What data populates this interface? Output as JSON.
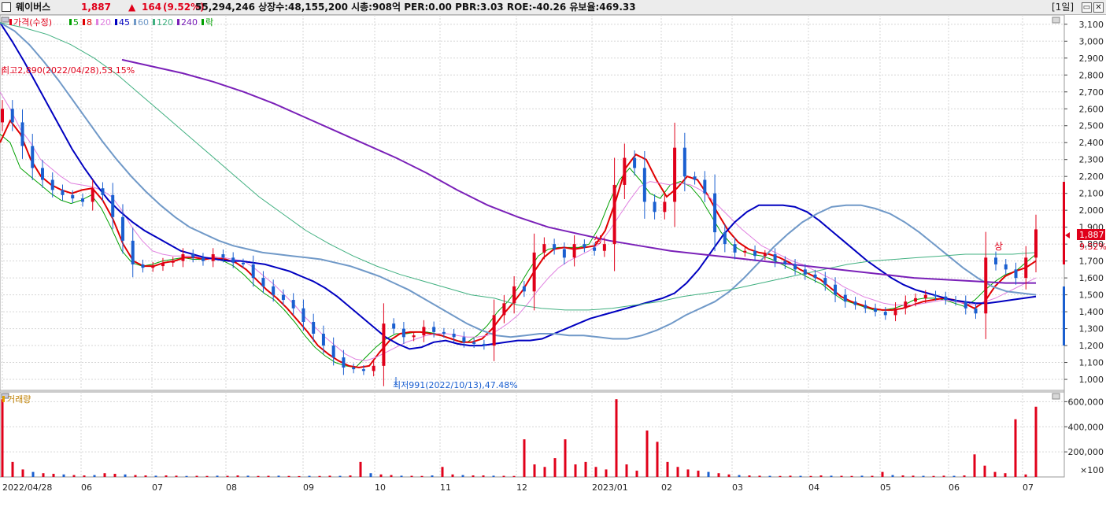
{
  "header": {
    "stock_name": "웨이버스",
    "price": "1,887",
    "change_arrow": "▲",
    "change": "164",
    "change_pct": "(9.52%)",
    "stats": "55,294,246  상장수:48,155,200  시총:908억  PER:0.00  PBR:3.03  ROE:-40.26  유보율:469.33",
    "period": "[1일]",
    "btn_restore": "▭",
    "btn_close": "✕"
  },
  "legend": {
    "items": [
      {
        "label": "가격(수정)",
        "color": "#e0001a"
      },
      {
        "label": "5",
        "color": "#00a000"
      },
      {
        "label": "8",
        "color": "#e00000"
      },
      {
        "label": "20",
        "color": "#e080e0"
      },
      {
        "label": "45",
        "color": "#0000c0"
      },
      {
        "label": "60",
        "color": "#7099c8"
      },
      {
        "label": "120",
        "color": "#40b080"
      },
      {
        "label": "240",
        "color": "#7a20b8"
      },
      {
        "label": "락",
        "color": "#00a000"
      }
    ],
    "volume_label": "거래량"
  },
  "annotations": {
    "high": "최고2,890(2022/04/28),53.15%",
    "low": "최저991(2022/10/13),47.48%",
    "limit_up_1": "상",
    "limit_up_2": "상",
    "current_price_tag": "1,887",
    "current_pct_tag": "9.52%",
    "volume_unit": "×100"
  },
  "chart_data": [
    {
      "type": "candlestick",
      "title": "",
      "y_ticks": [
        "3,100",
        "3,000",
        "2,900",
        "2,800",
        "2,700",
        "2,600",
        "2,500",
        "2,400",
        "2,300",
        "2,200",
        "2,100",
        "2,000",
        "1,900",
        "1,800",
        "1,700",
        "1,600",
        "1,500",
        "1,400",
        "1,300",
        "1,200",
        "1,100",
        "1,000"
      ],
      "ylim": [
        935,
        3155
      ],
      "x_ticks": [
        "2022/04/28",
        "06",
        "07",
        "08",
        "09",
        "10",
        "11",
        "12",
        "2023/01",
        "02",
        "03",
        "04",
        "05",
        "06",
        "07"
      ],
      "close_path": [
        2600,
        2520,
        2380,
        2250,
        2180,
        2120,
        2090,
        2070,
        2050,
        2130,
        2090,
        1960,
        1820,
        1680,
        1660,
        1670,
        1690,
        1700,
        1740,
        1720,
        1700,
        1740,
        1720,
        1690,
        1680,
        1600,
        1550,
        1500,
        1470,
        1420,
        1340,
        1270,
        1200,
        1130,
        1070,
        1060,
        1050,
        1080,
        1330,
        1300,
        1250,
        1260,
        1310,
        1280,
        1270,
        1250,
        1220,
        1210,
        1200,
        1380,
        1450,
        1550,
        1520,
        1750,
        1800,
        1770,
        1720,
        1800,
        1780,
        1760,
        1800,
        2150,
        2310,
        2250,
        2050,
        1990,
        2050,
        2370,
        2200,
        2180,
        2100,
        1870,
        1800,
        1750,
        1760,
        1730,
        1740,
        1700,
        1680,
        1650,
        1620,
        1600,
        1560,
        1500,
        1460,
        1440,
        1420,
        1400,
        1380,
        1420,
        1460,
        1480,
        1500,
        1490,
        1470,
        1460,
        1420,
        1390,
        1720,
        1680,
        1650,
        1600,
        1720,
        1887
      ],
      "series": [
        {
          "name": "5",
          "color": "#00a000",
          "values": [
            2450,
            2400,
            2250,
            2200,
            2150,
            2100,
            2060,
            2040,
            2060,
            2090,
            2010,
            1890,
            1760,
            1690,
            1670,
            1680,
            1700,
            1710,
            1720,
            1710,
            1710,
            1720,
            1700,
            1670,
            1620,
            1560,
            1510,
            1470,
            1410,
            1340,
            1260,
            1190,
            1140,
            1100,
            1080,
            1070,
            1130,
            1190,
            1240,
            1270,
            1270,
            1280,
            1280,
            1270,
            1250,
            1230,
            1220,
            1260,
            1320,
            1400,
            1460,
            1540,
            1640,
            1730,
            1770,
            1780,
            1780,
            1780,
            1800,
            1900,
            2050,
            2180,
            2250,
            2180,
            2100,
            2070,
            2150,
            2170,
            2140,
            2070,
            1970,
            1870,
            1800,
            1760,
            1740,
            1730,
            1710,
            1680,
            1650,
            1620,
            1590,
            1560,
            1510,
            1470,
            1450,
            1430,
            1410,
            1410,
            1420,
            1440,
            1470,
            1480,
            1480,
            1470,
            1450,
            1430,
            1470,
            1530,
            1580,
            1620,
            1640,
            1690,
            1740
          ]
        },
        {
          "name": "8",
          "color": "#e00000",
          "values": [
            2400,
            2530,
            2450,
            2300,
            2200,
            2150,
            2120,
            2100,
            2120,
            2130,
            2060,
            1950,
            1800,
            1700,
            1670,
            1670,
            1690,
            1700,
            1720,
            1720,
            1710,
            1720,
            1710,
            1690,
            1650,
            1590,
            1530,
            1480,
            1420,
            1350,
            1280,
            1200,
            1150,
            1110,
            1080,
            1070,
            1080,
            1160,
            1230,
            1270,
            1280,
            1280,
            1270,
            1260,
            1240,
            1220,
            1220,
            1240,
            1300,
            1380,
            1450,
            1530,
            1630,
            1720,
            1770,
            1780,
            1770,
            1780,
            1790,
            1880,
            2050,
            2250,
            2330,
            2300,
            2180,
            2080,
            2130,
            2200,
            2180,
            2090,
            1980,
            1880,
            1810,
            1770,
            1750,
            1740,
            1720,
            1690,
            1650,
            1620,
            1590,
            1540,
            1490,
            1460,
            1440,
            1420,
            1410,
            1410,
            1420,
            1440,
            1460,
            1470,
            1480,
            1470,
            1450,
            1420,
            1460,
            1550,
            1610,
            1640,
            1660,
            1700
          ]
        },
        {
          "name": "20",
          "color": "#e080e0",
          "values": [
            2700,
            2600,
            2480,
            2400,
            2300,
            2250,
            2200,
            2160,
            2150,
            2140,
            2120,
            2080,
            2000,
            1900,
            1820,
            1760,
            1740,
            1730,
            1730,
            1730,
            1720,
            1720,
            1720,
            1710,
            1700,
            1660,
            1610,
            1560,
            1500,
            1440,
            1370,
            1310,
            1250,
            1200,
            1150,
            1120,
            1110,
            1130,
            1160,
            1190,
            1220,
            1240,
            1260,
            1270,
            1270,
            1260,
            1250,
            1250,
            1260,
            1290,
            1330,
            1380,
            1450,
            1530,
            1600,
            1660,
            1700,
            1730,
            1760,
            1800,
            1880,
            1970,
            2060,
            2140,
            2170,
            2160,
            2150,
            2160,
            2150,
            2120,
            2070,
            2010,
            1950,
            1890,
            1840,
            1790,
            1760,
            1730,
            1700,
            1680,
            1650,
            1620,
            1590,
            1550,
            1520,
            1490,
            1470,
            1450,
            1440,
            1440,
            1440,
            1450,
            1460,
            1470,
            1460,
            1450,
            1440,
            1460,
            1480,
            1510,
            1540,
            1570,
            1600
          ]
        },
        {
          "name": "45",
          "color": "#0000c0",
          "values": [
            3110,
            3000,
            2880,
            2750,
            2620,
            2490,
            2360,
            2250,
            2150,
            2060,
            1990,
            1930,
            1880,
            1840,
            1800,
            1760,
            1740,
            1720,
            1710,
            1700,
            1700,
            1690,
            1680,
            1660,
            1640,
            1610,
            1580,
            1540,
            1490,
            1430,
            1370,
            1310,
            1250,
            1210,
            1180,
            1190,
            1220,
            1230,
            1210,
            1200,
            1200,
            1210,
            1220,
            1230,
            1230,
            1240,
            1270,
            1300,
            1330,
            1360,
            1380,
            1400,
            1420,
            1440,
            1460,
            1480,
            1510,
            1570,
            1650,
            1750,
            1850,
            1930,
            1990,
            2030,
            2030,
            2030,
            2020,
            1990,
            1940,
            1880,
            1820,
            1760,
            1700,
            1650,
            1600,
            1560,
            1530,
            1510,
            1490,
            1470,
            1460,
            1450,
            1450,
            1460,
            1470,
            1480,
            1490
          ]
        },
        {
          "name": "60",
          "color": "#7099c8",
          "values": [
            3110,
            3060,
            2980,
            2880,
            2770,
            2650,
            2530,
            2410,
            2300,
            2200,
            2110,
            2030,
            1960,
            1900,
            1860,
            1820,
            1790,
            1770,
            1750,
            1740,
            1730,
            1720,
            1710,
            1690,
            1670,
            1640,
            1610,
            1570,
            1530,
            1480,
            1430,
            1380,
            1330,
            1290,
            1260,
            1250,
            1260,
            1270,
            1270,
            1260,
            1260,
            1250,
            1240,
            1240,
            1260,
            1290,
            1330,
            1380,
            1420,
            1460,
            1520,
            1600,
            1690,
            1780,
            1860,
            1930,
            1980,
            2020,
            2030,
            2030,
            2010,
            1980,
            1930,
            1870,
            1800,
            1730,
            1660,
            1600,
            1550,
            1520,
            1510,
            1500
          ]
        },
        {
          "name": "120",
          "color": "#40b080",
          "values": [
            3110,
            3080,
            3040,
            2980,
            2900,
            2800,
            2680,
            2560,
            2440,
            2320,
            2200,
            2080,
            1980,
            1880,
            1800,
            1730,
            1670,
            1620,
            1580,
            1540,
            1500,
            1480,
            1440,
            1420,
            1410,
            1410,
            1420,
            1440,
            1460,
            1490,
            1510,
            1530,
            1560,
            1590,
            1620,
            1650,
            1680,
            1700,
            1710,
            1720,
            1730,
            1740,
            1740,
            1740,
            1750
          ]
        },
        {
          "name": "240",
          "color": "#7a20b8",
          "values": [
            2890,
            2850,
            2810,
            2760,
            2700,
            2630,
            2550,
            2470,
            2390,
            2310,
            2220,
            2120,
            2030,
            1960,
            1900,
            1860,
            1820,
            1790,
            1760,
            1740,
            1720,
            1700,
            1680,
            1660,
            1640,
            1620,
            1600,
            1590,
            1580,
            1570,
            1570
          ]
        }
      ]
    },
    {
      "type": "bar",
      "title": "거래량",
      "y_ticks": [
        "600,000",
        "400,000",
        "200,000"
      ],
      "ylim": [
        0,
        640000
      ],
      "values": [
        620000,
        120000,
        60000,
        40000,
        30000,
        25000,
        20000,
        15000,
        12000,
        15000,
        30000,
        25000,
        20000,
        15000,
        12000,
        10000,
        12000,
        10000,
        8000,
        9000,
        8000,
        10000,
        9000,
        12000,
        10000,
        8000,
        9000,
        10000,
        8000,
        7000,
        9000,
        8000,
        10000,
        9000,
        12000,
        120000,
        30000,
        20000,
        15000,
        10000,
        9000,
        8000,
        12000,
        80000,
        20000,
        15000,
        12000,
        12000,
        10000,
        9000,
        8000,
        300000,
        100000,
        80000,
        150000,
        300000,
        100000,
        120000,
        80000,
        60000,
        620000,
        100000,
        50000,
        370000,
        280000,
        120000,
        80000,
        60000,
        50000,
        40000,
        30000,
        20000,
        15000,
        12000,
        10000,
        9000,
        8000,
        10000,
        9000,
        8000,
        12000,
        10000,
        9000,
        8000,
        10000,
        9000,
        40000,
        15000,
        12000,
        10000,
        9000,
        8000,
        10000,
        9000,
        12000,
        180000,
        90000,
        40000,
        30000,
        460000,
        20000,
        560000
      ],
      "colors_up_down": {
        "up": "#e0001a",
        "down": "#1a5fd0"
      }
    }
  ]
}
